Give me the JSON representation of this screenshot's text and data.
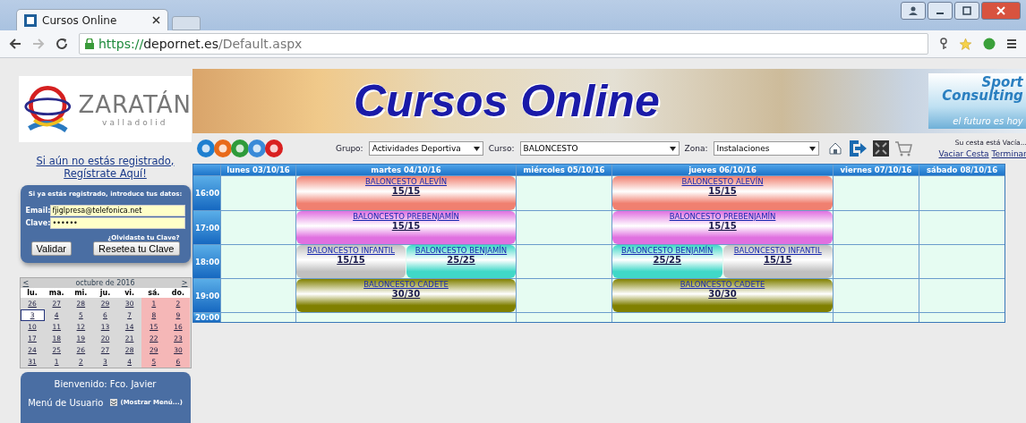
{
  "browser": {
    "tab_title": "Cursos Online",
    "url_scheme": "https://",
    "url_host": "depornet.es",
    "url_path": "/Default.aspx"
  },
  "sidebar": {
    "register_link": "Si aún no estás registrado, Regístrate Aquí!",
    "login": {
      "heading": "Si ya estás registrado, introduce tus datos:",
      "fields": [
        {
          "label": "Email:",
          "value": "fjiglpresa@telefonica.net"
        },
        {
          "label": "Clave:",
          "value": "••••••"
        }
      ],
      "forgot_link": "¿Olvidaste tu Clave?",
      "buttons": [
        "Validar",
        "Resetea tu Clave"
      ]
    },
    "calendar": {
      "prev": "<",
      "title": "octubre de 2016",
      "next": ">",
      "weekdays": [
        "lu.",
        "ma.",
        "mi.",
        "ju.",
        "vi.",
        "sá.",
        "do."
      ],
      "weeks": [
        [
          {
            "day": "26",
            "selected": false
          },
          {
            "day": "27",
            "selected": false
          },
          {
            "day": "28",
            "selected": false
          },
          {
            "day": "29",
            "selected": false
          },
          {
            "day": "30",
            "selected": false
          },
          {
            "day": "1",
            "selected": false
          },
          {
            "day": "2",
            "selected": false
          }
        ],
        [
          {
            "day": "3",
            "selected": true
          },
          {
            "day": "4",
            "selected": false
          },
          {
            "day": "5",
            "selected": false
          },
          {
            "day": "6",
            "selected": false
          },
          {
            "day": "7",
            "selected": false
          },
          {
            "day": "8",
            "selected": false
          },
          {
            "day": "9",
            "selected": false
          }
        ],
        [
          {
            "day": "10",
            "selected": false
          },
          {
            "day": "11",
            "selected": false
          },
          {
            "day": "12",
            "selected": false
          },
          {
            "day": "13",
            "selected": false
          },
          {
            "day": "14",
            "selected": false
          },
          {
            "day": "15",
            "selected": false
          },
          {
            "day": "16",
            "selected": false
          }
        ],
        [
          {
            "day": "17",
            "selected": false
          },
          {
            "day": "18",
            "selected": false
          },
          {
            "day": "19",
            "selected": false
          },
          {
            "day": "20",
            "selected": false
          },
          {
            "day": "21",
            "selected": false
          },
          {
            "day": "22",
            "selected": false
          },
          {
            "day": "23",
            "selected": false
          }
        ],
        [
          {
            "day": "24",
            "selected": false
          },
          {
            "day": "25",
            "selected": false
          },
          {
            "day": "26",
            "selected": false
          },
          {
            "day": "27",
            "selected": false
          },
          {
            "day": "28",
            "selected": false
          },
          {
            "day": "29",
            "selected": false
          },
          {
            "day": "30",
            "selected": false
          }
        ],
        [
          {
            "day": "31",
            "selected": false
          },
          {
            "day": "1",
            "selected": false
          },
          {
            "day": "2",
            "selected": false
          },
          {
            "day": "3",
            "selected": false
          },
          {
            "day": "4",
            "selected": false
          },
          {
            "day": "5",
            "selected": false
          },
          {
            "day": "6",
            "selected": false
          }
        ]
      ]
    },
    "welcome": {
      "greeting": "Bienvenido: Fco. Javier",
      "menu_label": "Menú de Usuario",
      "menu_toggle": "(Mostrar Menú...)"
    }
  },
  "logo": {
    "name": "ZARATÁN",
    "subtitle": "valladolid"
  },
  "banner": {
    "title": "Cursos Online",
    "brand": "Sport Consulting",
    "slogan": "el futuro es hoy"
  },
  "filters": [
    {
      "label": "Grupo:",
      "value": "Actividades Deportiva"
    },
    {
      "label": "Curso:",
      "value": "BALONCESTO"
    },
    {
      "label": "Zona:",
      "value": "Instalaciones"
    }
  ],
  "cart": {
    "status": "Su cesta está Vacía...",
    "links": [
      "Vaciar Cesta",
      "Terminar"
    ]
  },
  "schedule": {
    "columns": [
      "lunes 03/10/16",
      "martes 04/10/16",
      "miércoles 05/10/16",
      "jueves 06/10/16",
      "viernes 07/10/16",
      "sábado 08/10/16"
    ],
    "rows": [
      {
        "time": "16:00",
        "cells": [
          {},
          {
            "courses": [
              {
                "name": "BALONCESTO ALEVÍN",
                "count": "15/15",
                "color": "#f08070"
              }
            ]
          },
          {},
          {
            "courses": [
              {
                "name": "BALONCESTO ALEVÍN",
                "count": "15/15",
                "color": "#f08070"
              }
            ]
          },
          {},
          {}
        ]
      },
      {
        "time": "17:00",
        "cells": [
          {},
          {
            "courses": [
              {
                "name": "BALONCESTO PREBENJAMÍN",
                "count": "15/15",
                "color": "#e070e0"
              }
            ]
          },
          {},
          {
            "courses": [
              {
                "name": "BALONCESTO PREBENJAMÍN",
                "count": "15/15",
                "color": "#e070e0"
              }
            ]
          },
          {},
          {}
        ]
      },
      {
        "time": "18:00",
        "cells": [
          {},
          {
            "courses": [
              {
                "name": "BALONCESTO INFANTIL",
                "count": "15/15",
                "color": "#c0c0c0"
              },
              {
                "name": "BALONCESTO BENJAMÍN",
                "count": "25/25",
                "color": "#40d8c8"
              }
            ]
          },
          {},
          {
            "courses": [
              {
                "name": "BALONCESTO BENJAMÍN",
                "count": "25/25",
                "color": "#40d8c8"
              },
              {
                "name": "BALONCESTO INFANTIL",
                "count": "15/15",
                "color": "#c0c0c0"
              }
            ]
          },
          {},
          {}
        ]
      },
      {
        "time": "19:00",
        "cells": [
          {},
          {
            "courses": [
              {
                "name": "BALONCESTO CADETE",
                "count": "30/30",
                "color": "#808000"
              }
            ]
          },
          {},
          {
            "courses": [
              {
                "name": "BALONCESTO CADETE",
                "count": "30/30",
                "color": "#808000"
              }
            ]
          },
          {},
          {}
        ]
      },
      {
        "time": "20:00",
        "cells": [
          {},
          {},
          {},
          {},
          {},
          {}
        ]
      }
    ]
  }
}
